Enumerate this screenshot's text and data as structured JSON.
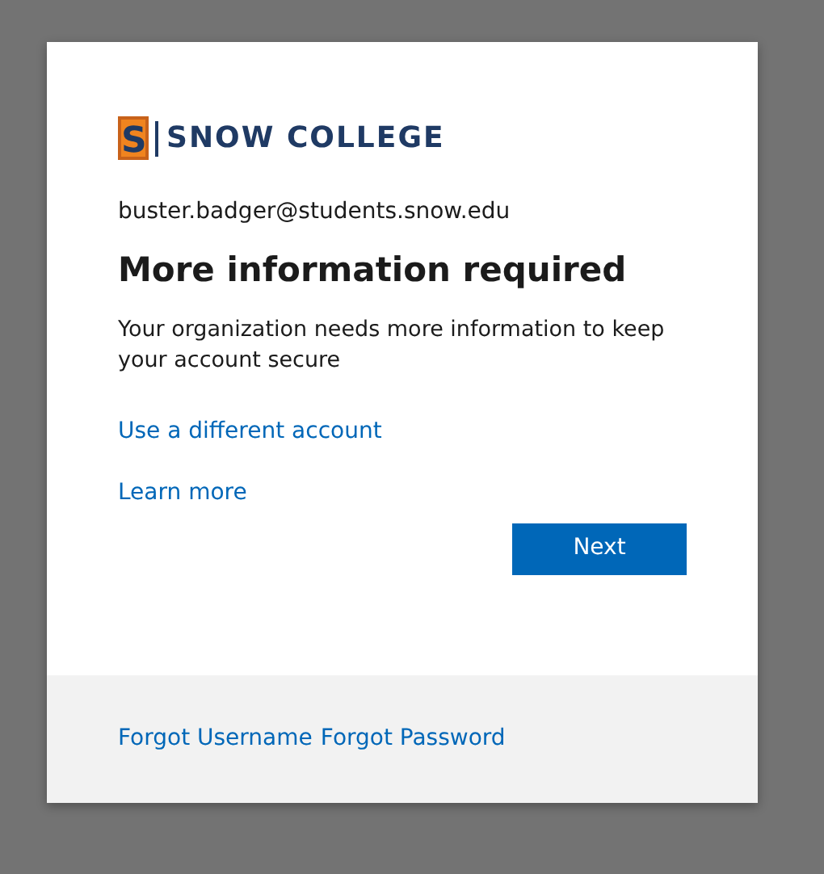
{
  "logo": {
    "mark": "S",
    "name": "SNOW COLLEGE"
  },
  "identity": "buster.badger@students.snow.edu",
  "title": "More information required",
  "description": "Your organization needs more information to keep your account secure",
  "links": [
    "Use a different account",
    "Learn more"
  ],
  "primary_button": "Next",
  "footer_links": [
    "Forgot Username",
    "Forgot Password"
  ]
}
